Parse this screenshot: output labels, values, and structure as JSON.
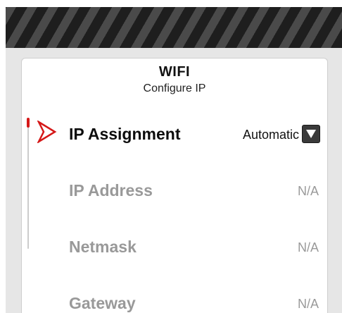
{
  "header": {
    "title": "WIFI",
    "subtitle": "Configure IP"
  },
  "colors": {
    "accent": "#d51818",
    "inactive_text": "#999999",
    "active_text": "#0d0d0d"
  },
  "settings": [
    {
      "label": "IP Assignment",
      "value": "Automatic",
      "selected": true,
      "has_dropdown": true
    },
    {
      "label": "IP Address",
      "value": "N/A",
      "selected": false
    },
    {
      "label": "Netmask",
      "value": "N/A",
      "selected": false
    },
    {
      "label": "Gateway",
      "value": "N/A",
      "selected": false
    }
  ],
  "icons": {
    "selector": "chevron-right-outline-icon",
    "dropdown": "triangle-down-icon"
  }
}
